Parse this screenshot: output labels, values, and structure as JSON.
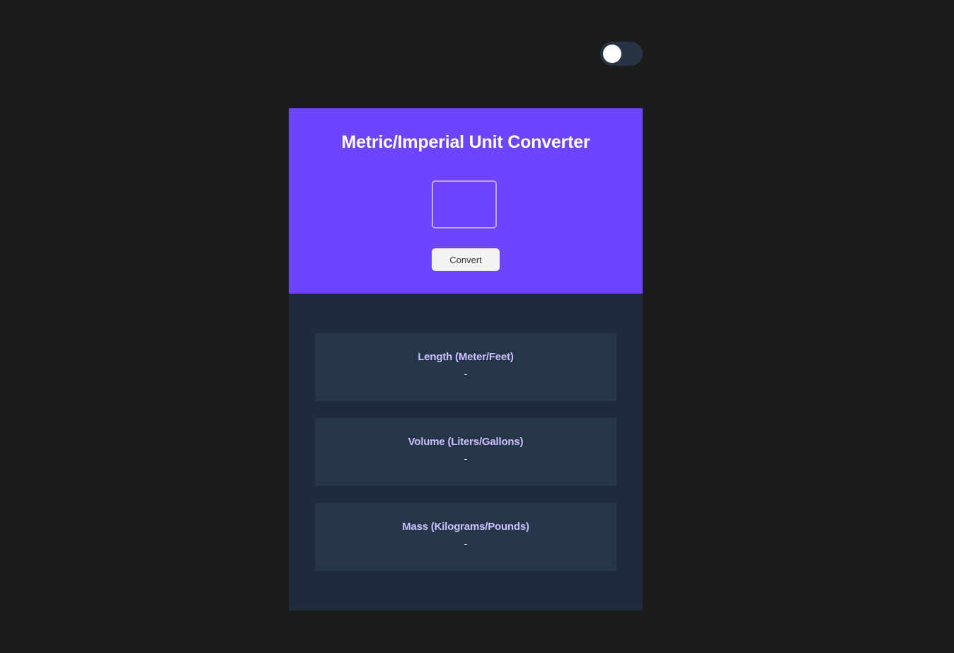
{
  "theme_toggle": {
    "state": "off"
  },
  "header": {
    "title": "Metric/Imperial Unit Converter",
    "input_value": "",
    "convert_label": "Convert"
  },
  "results": [
    {
      "title": "Length (Meter/Feet)",
      "value": "-"
    },
    {
      "title": "Volume (Liters/Gallons)",
      "value": "-"
    },
    {
      "title": "Mass (Kilograms/Pounds)",
      "value": "-"
    }
  ],
  "colors": {
    "page_bg": "#1c1c1c",
    "header_bg": "#6d44ff",
    "panel_bg": "#1f2a3c",
    "card_bg": "#273549",
    "card_title": "#ccc1ff",
    "toggle_track": "#273444"
  }
}
